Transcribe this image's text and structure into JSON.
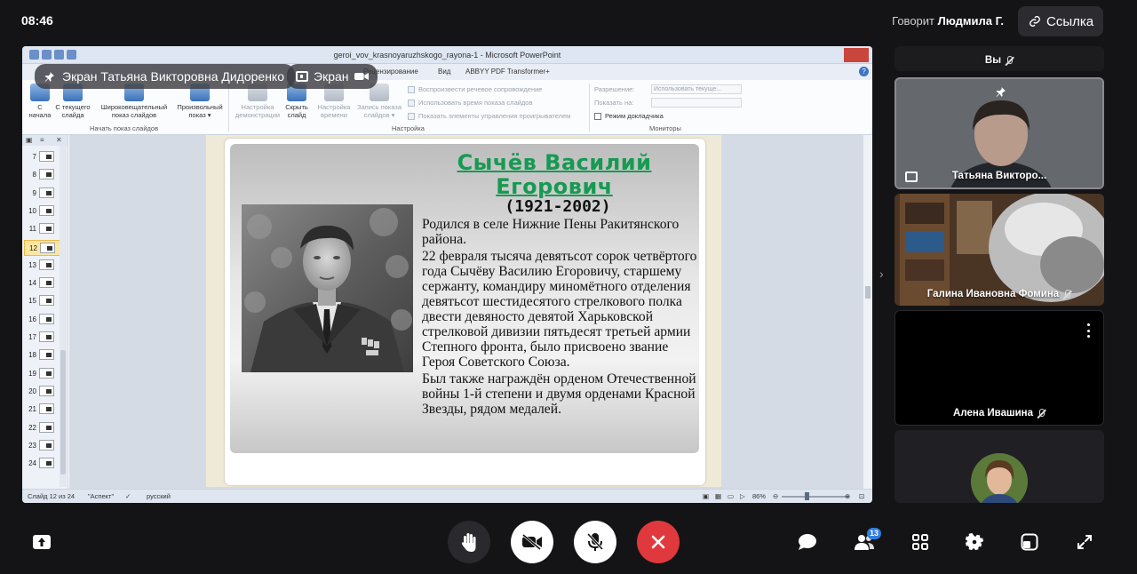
{
  "clock": "08:46",
  "speaking": {
    "prefix": "Говорит",
    "name": "Людмила Г."
  },
  "link_button": {
    "label": "Ссылка",
    "icon": "link-icon"
  },
  "screen_share": {
    "presenter_label": "Экран Татьяна Викторовна Дидоренко",
    "screen_label": "Экран",
    "app": {
      "window_title": "geroi_vov_krasnoyaruzhskogo_rayona-1 - Microsoft PowerPoint",
      "tabs": [
        "Рецензирование",
        "Вид",
        "ABBYY PDF Transformer+"
      ],
      "ribbon": {
        "buttons": [
          {
            "label": "С\nначала",
            "dim": false
          },
          {
            "label": "С текущего\nслайда",
            "dim": false
          },
          {
            "label": "Широковещательный\nпоказ слайдов",
            "dim": false
          },
          {
            "label": "Произвольный\nпоказ ▾",
            "dim": false
          },
          {
            "label": "Настройка\nдемонстрации",
            "dim": true
          },
          {
            "label": "Скрыть\nслайд",
            "dim": false
          },
          {
            "label": "Настройка\nвремени",
            "dim": true
          },
          {
            "label": "Запись показа\nслайдов ▾",
            "dim": true
          }
        ],
        "groups": [
          "Начать показ слайдов",
          "Настройка",
          "Мониторы"
        ],
        "checks": [
          {
            "label": "Воспроизвести речевое сопровождение",
            "on": false
          },
          {
            "label": "Использовать время показа слайдов",
            "on": false
          },
          {
            "label": "Показать элементы управления проигрывателем",
            "on": false
          },
          {
            "label": "Режим докладчика",
            "on": true
          }
        ],
        "monitor_labels": [
          "Разрешение:",
          "Показать на:"
        ],
        "resolution_value": "Использовать текуще..."
      },
      "thumbnails": [
        7,
        8,
        9,
        10,
        11,
        12,
        13,
        14,
        15,
        16,
        17,
        18,
        19,
        20,
        21,
        22,
        23,
        24
      ],
      "selected_slide": 12,
      "status": {
        "slide_info": "Слайд 12 из 24",
        "theme": "\"Аспект\"",
        "language": "русский",
        "zoom": "86%"
      }
    },
    "slide": {
      "title": "Сычёв Василий Егорович",
      "years": "(1921-2002)",
      "paragraphs": [
        "Родился в селе Нижние Пены Ракитянского района.",
        "22 февраля тысяча девятьсот сорок четвёртого года Сычёву Василию Егоровичу, старшему сержанту, командиру миномётного отделения девятьсот шестидесятого стрелкового полка двести девяносто девятой Харьковской стрелковой  дивизии пятьдесят третьей  армии Степного фронта, было  присвоено  звание Героя Советского Союза.",
        "Был также награждён орденом Отечественной войны 1-й степени и двумя орденами Красной Звезды, рядом медалей."
      ]
    }
  },
  "participants": {
    "you": "Вы",
    "tiles": [
      {
        "name": "Татьяна Викторо...",
        "pinned": true,
        "sharing": true
      },
      {
        "name": "Галина Ивановна Фомина",
        "muted": true
      },
      {
        "name": "Алена Ивашина",
        "muted": true
      },
      {
        "name": ""
      }
    ]
  },
  "controls": {
    "participants_count": "13",
    "icons": [
      "share-screen-icon",
      "raise-hand-icon",
      "camera-off-icon",
      "mic-off-icon",
      "end-call-icon",
      "chat-icon",
      "participants-icon",
      "grid-icon",
      "settings-icon",
      "layout-icon",
      "fullscreen-icon"
    ]
  }
}
